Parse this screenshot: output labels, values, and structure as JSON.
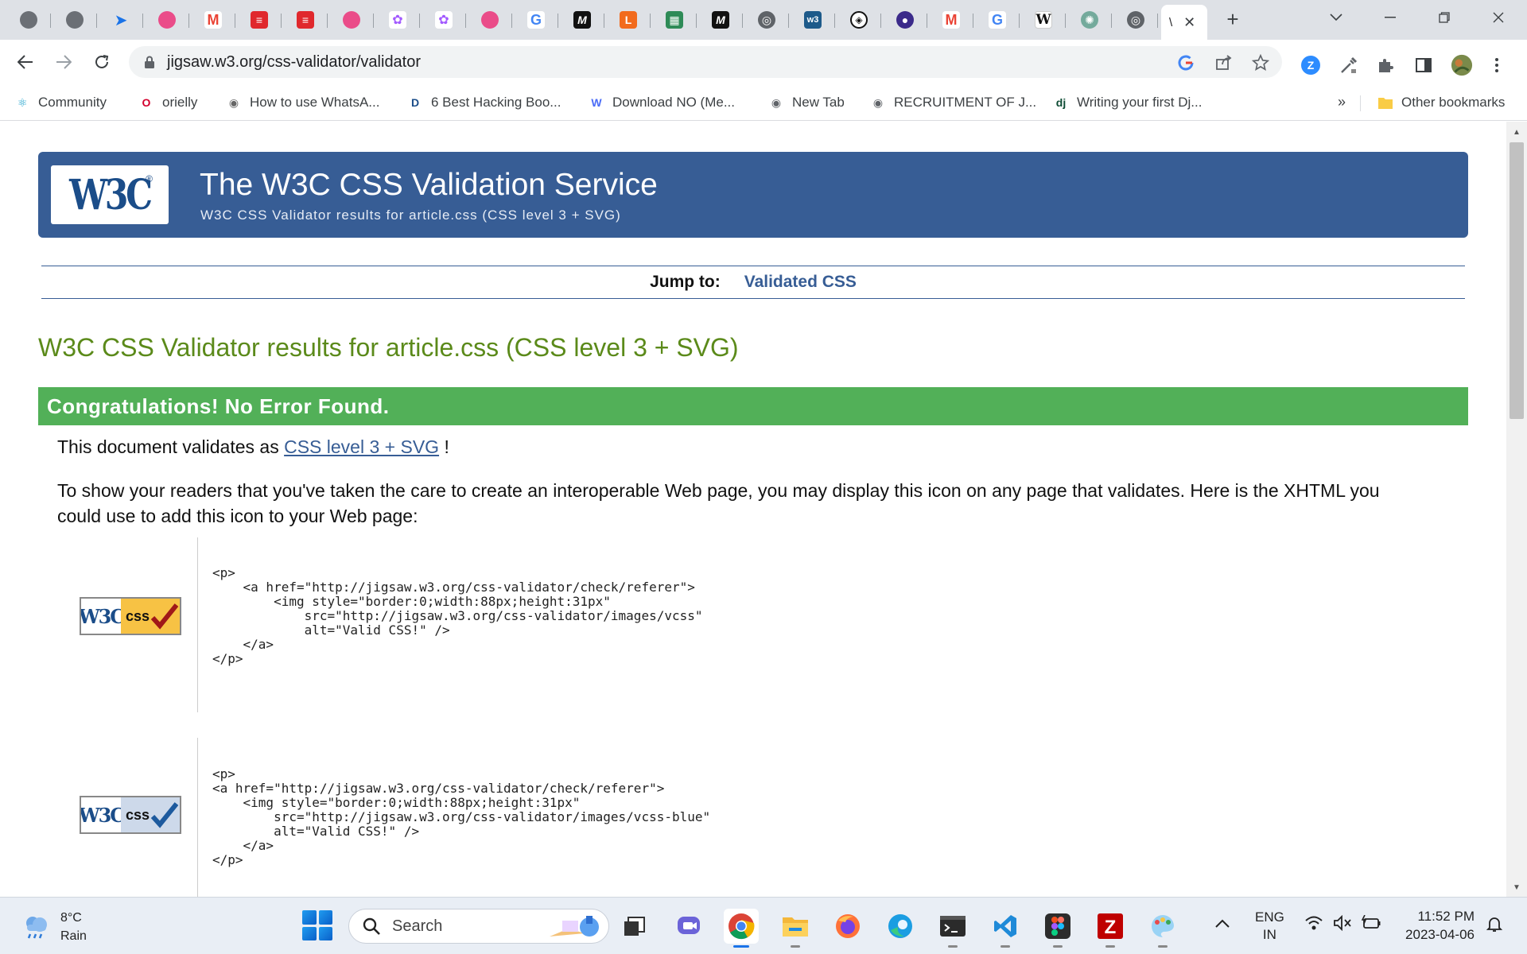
{
  "browser": {
    "tabs": [
      {
        "icon": "globe-icon",
        "glyph": "",
        "cls": "fav-globe"
      },
      {
        "icon": "globe-icon",
        "glyph": "",
        "cls": "fav-globe"
      },
      {
        "icon": "send-arrow-icon",
        "glyph": "➤",
        "cls": "fav-arrow"
      },
      {
        "icon": "dribbble-icon",
        "glyph": "",
        "cls": "fav-dribbble"
      },
      {
        "icon": "gmail-icon",
        "glyph": "M",
        "cls": "fav-gmail"
      },
      {
        "icon": "red-stack-icon",
        "glyph": "≡",
        "cls": "fav-red"
      },
      {
        "icon": "red-stack-icon",
        "glyph": "≡",
        "cls": "fav-red"
      },
      {
        "icon": "dribbble-icon",
        "glyph": "",
        "cls": "fav-dribbble"
      },
      {
        "icon": "figma-icon",
        "glyph": "✿",
        "cls": "fav-figma"
      },
      {
        "icon": "figma-icon",
        "glyph": "✿",
        "cls": "fav-figma"
      },
      {
        "icon": "dribbble-icon",
        "glyph": "",
        "cls": "fav-dribbble"
      },
      {
        "icon": "google-icon",
        "glyph": "G",
        "cls": "fav-google"
      },
      {
        "icon": "medium-icon",
        "glyph": "M",
        "cls": "fav-dark"
      },
      {
        "icon": "orange-l-icon",
        "glyph": "L",
        "cls": "fav-orange"
      },
      {
        "icon": "sheet-icon",
        "glyph": "▦",
        "cls": "fav-green"
      },
      {
        "icon": "medium-icon",
        "glyph": "M",
        "cls": "fav-dark"
      },
      {
        "icon": "chrome-icon",
        "glyph": "◎",
        "cls": "fav-chrome"
      },
      {
        "icon": "w3-icon",
        "glyph": "w3",
        "cls": "fav-w3"
      },
      {
        "icon": "codepen-icon",
        "glyph": "◈",
        "cls": "fav-codepen"
      },
      {
        "icon": "purple-circle-icon",
        "glyph": "●",
        "cls": "fav-purple"
      },
      {
        "icon": "gmail-icon",
        "glyph": "M",
        "cls": "fav-gmail"
      },
      {
        "icon": "google-icon",
        "glyph": "G",
        "cls": "fav-google"
      },
      {
        "icon": "wikipedia-icon",
        "glyph": "W",
        "cls": "fav-wiki"
      },
      {
        "icon": "chatgpt-icon",
        "glyph": "✺",
        "cls": "fav-gpt"
      },
      {
        "icon": "chrome-icon",
        "glyph": "◎",
        "cls": "fav-chrome"
      }
    ],
    "active_tab_label": "\\",
    "url": "jigsaw.w3.org/css-validator/validator",
    "bookmarks": [
      {
        "label": "Community",
        "icon": "react-icon",
        "glyph": "⚛",
        "color": "#149eca"
      },
      {
        "label": "orielly",
        "icon": "oreilly-icon",
        "glyph": "O",
        "color": "#d3002d"
      },
      {
        "label": "How to use WhatsA...",
        "icon": "globe-icon",
        "glyph": "◉",
        "color": "#666"
      },
      {
        "label": "6 Best Hacking Boo...",
        "icon": "d-icon",
        "glyph": "D",
        "color": "#1b4d89"
      },
      {
        "label": "Download NO (Me...",
        "icon": "w-icon",
        "glyph": "W",
        "color": "#4a6cf7"
      },
      {
        "label": "New Tab",
        "icon": "globe-icon",
        "glyph": "◉",
        "color": "#5f6368"
      },
      {
        "label": "RECRUITMENT OF J...",
        "icon": "globe-icon",
        "glyph": "◉",
        "color": "#5f6368"
      },
      {
        "label": "Writing your first Dj...",
        "icon": "django-icon",
        "glyph": "dj",
        "color": "#0c4b33"
      }
    ],
    "bookmarks_more": "»",
    "other_bookmarks": "Other bookmarks"
  },
  "page": {
    "banner_title": "The W3C CSS Validation Service",
    "banner_subtitle": "W3C CSS Validator results for article.css (CSS level 3 + SVG)",
    "logo_text": "W3C",
    "jump_label": "Jump to:",
    "jump_link": "Validated CSS",
    "results_title": "W3C CSS Validator results for article.css (CSS level 3 + SVG)",
    "congrats": "Congratulations! No Error Found.",
    "validates_prefix": "This document validates as",
    "validates_link": "CSS level 3 + SVG",
    "validates_suffix": "!",
    "icon_paragraph_line1": "To show your readers that you've taken the care to create an interoperable Web page, you may display this icon on any page that validates. Here is the XHTML you",
    "icon_paragraph_line2": "could use to add this icon to your Web page:",
    "badge_w3c": "W3C",
    "badge_css": "css",
    "code_gold": "<p>\n    <a href=\"http://jigsaw.w3.org/css-validator/check/referer\">\n        <img style=\"border:0;width:88px;height:31px\"\n            src=\"http://jigsaw.w3.org/css-validator/images/vcss\"\n            alt=\"Valid CSS!\" />\n    </a>\n</p>",
    "code_blue": "<p>\n<a href=\"http://jigsaw.w3.org/css-validator/check/referer\">\n    <img style=\"border:0;width:88px;height:31px\"\n        src=\"http://jigsaw.w3.org/css-validator/images/vcss-blue\"\n        alt=\"Valid CSS!\" />\n    </a>\n</p>"
  },
  "taskbar": {
    "temperature": "8°C",
    "condition": "Rain",
    "search_label": "Search",
    "lang_line1": "ENG",
    "lang_line2": "IN",
    "time": "11:52 PM",
    "date": "2023-04-06"
  },
  "colors": {
    "banner": "#375d95",
    "congrats": "#52b058",
    "results_title": "#5b8a1a"
  }
}
